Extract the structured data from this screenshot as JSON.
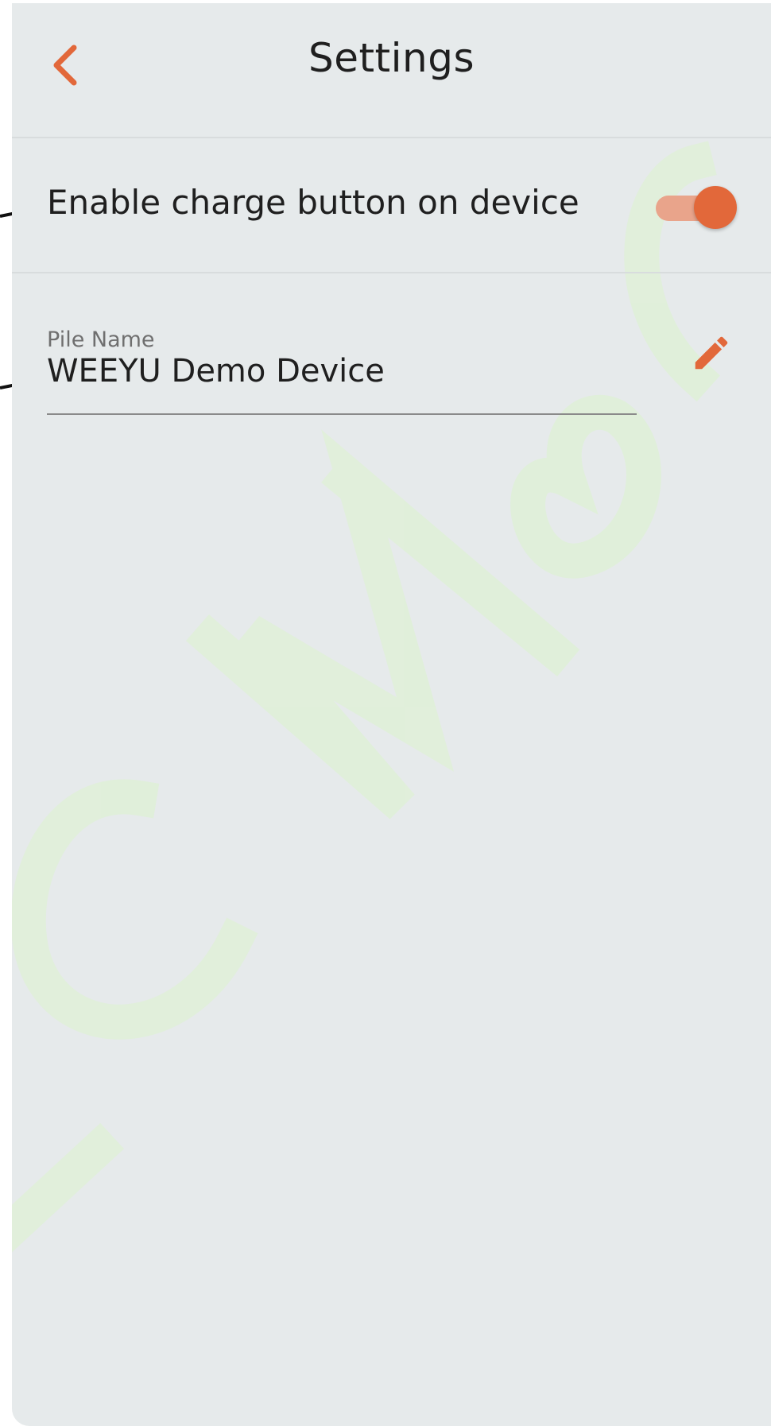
{
  "header": {
    "title": "Settings",
    "back_icon": "chevron-left-icon"
  },
  "settings": {
    "charge_button_label": "Enable charge button on device",
    "charge_button_enabled": true,
    "pile_name_label": "Pile Name",
    "pile_name_value": "WEEYU Demo Device",
    "edit_icon": "pencil-icon"
  },
  "colors": {
    "accent": "#e2683a",
    "accent_light": "#e9a48b",
    "background": "#e6eaeb",
    "divider": "#d8dcdd",
    "watermark": "#dff0d8"
  }
}
